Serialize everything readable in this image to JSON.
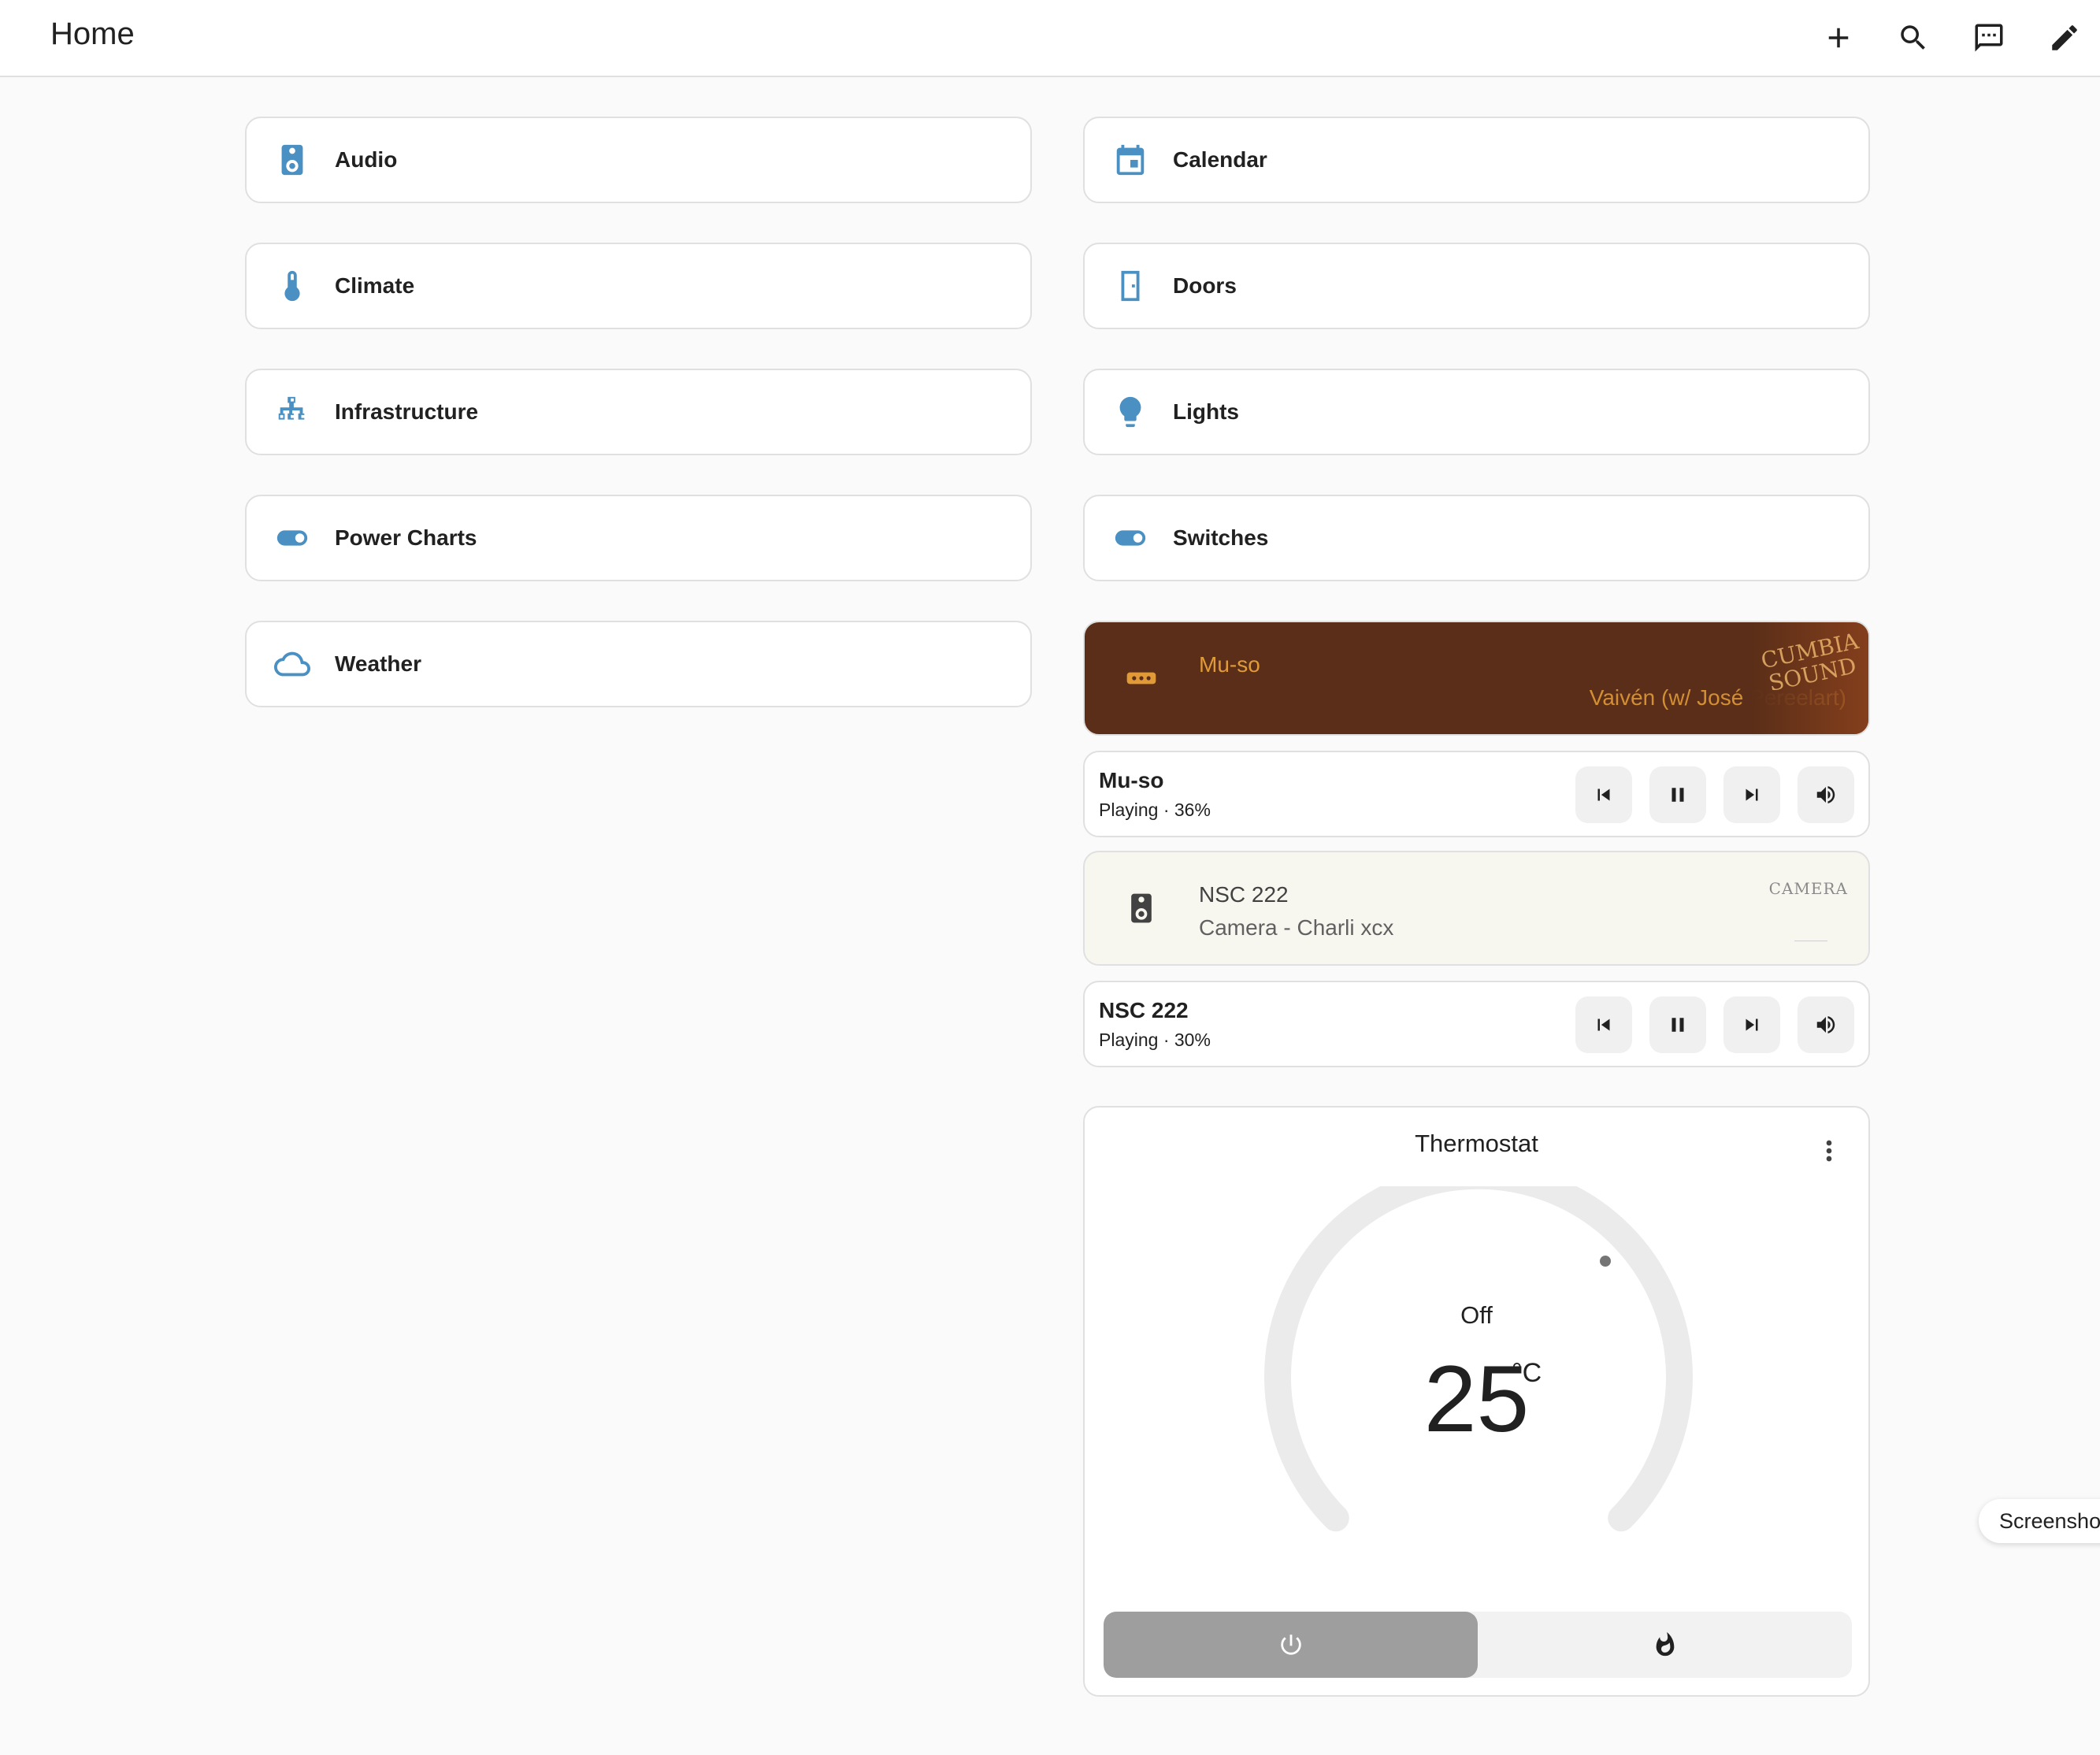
{
  "header": {
    "title": "Home",
    "actions": [
      {
        "name": "add",
        "icon": "plus-icon"
      },
      {
        "name": "search",
        "icon": "search-icon"
      },
      {
        "name": "assist",
        "icon": "chat-icon"
      },
      {
        "name": "edit",
        "icon": "pencil-icon"
      }
    ]
  },
  "tiles_left": [
    {
      "label": "Audio",
      "icon": "speaker-icon"
    },
    {
      "label": "Climate",
      "icon": "thermometer-icon"
    },
    {
      "label": "Infrastructure",
      "icon": "network-icon"
    },
    {
      "label": "Power Charts",
      "icon": "toggle-icon"
    },
    {
      "label": "Weather",
      "icon": "cloud-icon"
    }
  ],
  "tiles_right": [
    {
      "label": "Calendar",
      "icon": "calendar-icon"
    },
    {
      "label": "Doors",
      "icon": "door-icon"
    },
    {
      "label": "Lights",
      "icon": "bulb-icon"
    },
    {
      "label": "Switches",
      "icon": "toggle-icon"
    }
  ],
  "media": [
    {
      "hero_name": "Mu-so",
      "hero_track": "Vaivén (w/ José Pereelart)",
      "name": "Mu-so",
      "state": "Playing · 36%",
      "volume_percent": 36,
      "art_text": "CUMBIA SOUND",
      "colors": {
        "bg": "#5a2e18",
        "fg": "#e09a38"
      }
    },
    {
      "hero_name": "NSC 222",
      "hero_track": "Camera - Charli xcx",
      "name": "NSC 222",
      "state": "Playing · 30%",
      "volume_percent": 30,
      "art_text": "CAMERA",
      "colors": {
        "bg": "#f8f7ef",
        "fg": "#616161"
      }
    }
  ],
  "thermostat": {
    "title": "Thermostat",
    "mode": "Off",
    "temperature": "25",
    "unit": "°C",
    "modes": [
      {
        "name": "off",
        "icon": "power-icon",
        "active": true
      },
      {
        "name": "heat",
        "icon": "flame-icon",
        "active": false
      }
    ]
  },
  "toast": {
    "text": "Screenshot"
  }
}
